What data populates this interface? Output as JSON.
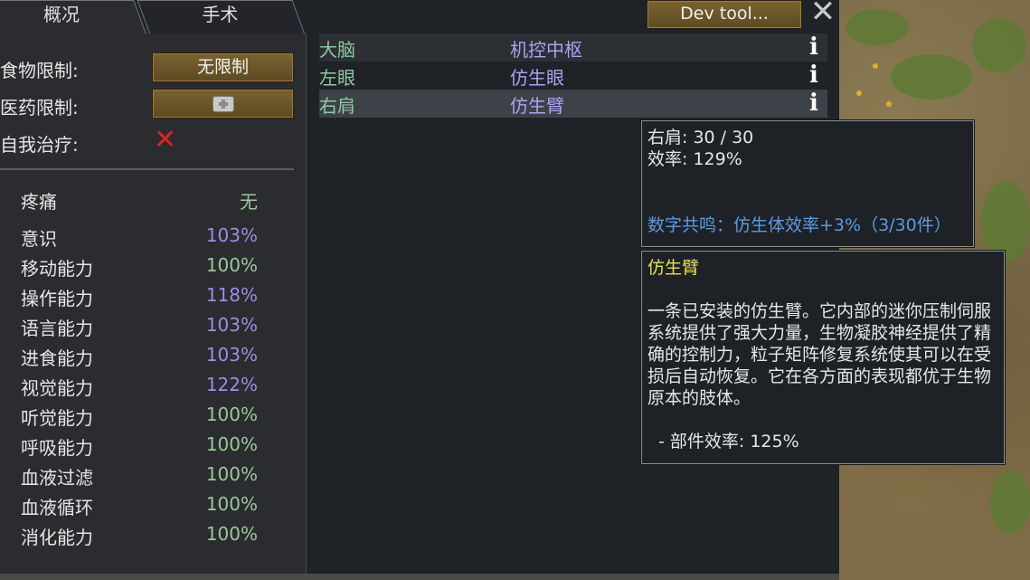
{
  "tabs": {
    "overview": "概况",
    "surgery": "手术"
  },
  "settings": {
    "food_label": "食物限制:",
    "food_value": "无限制",
    "medicine_label": "医药限制:",
    "medicine_icon": "medicine-icon",
    "self_tend_label": "自我治疗:",
    "self_tend_icon": "red-x-icon"
  },
  "pain": {
    "label": "疼痛",
    "value": "无"
  },
  "capacities": [
    {
      "name": "意识",
      "value": "103%",
      "color": "#9a8ee6"
    },
    {
      "name": "移动能力",
      "value": "100%",
      "color": "#9cc79a"
    },
    {
      "name": "操作能力",
      "value": "118%",
      "color": "#9a8ee6"
    },
    {
      "name": "语言能力",
      "value": "103%",
      "color": "#9a8ee6"
    },
    {
      "name": "进食能力",
      "value": "103%",
      "color": "#9a8ee6"
    },
    {
      "name": "视觉能力",
      "value": "122%",
      "color": "#9a8ee6"
    },
    {
      "name": "听觉能力",
      "value": "100%",
      "color": "#9cc79a"
    },
    {
      "name": "呼吸能力",
      "value": "100%",
      "color": "#9cc79a"
    },
    {
      "name": "血液过滤",
      "value": "100%",
      "color": "#9cc79a"
    },
    {
      "name": "血液循环",
      "value": "100%",
      "color": "#9cc79a"
    },
    {
      "name": "消化能力",
      "value": "100%",
      "color": "#9cc79a"
    }
  ],
  "parts": [
    {
      "part": "大脑",
      "hediff": "机控中枢"
    },
    {
      "part": "左眼",
      "hediff": "仿生眼"
    },
    {
      "part": "右肩",
      "hediff": "仿生臂"
    }
  ],
  "dev_tool": "Dev tool...",
  "tooltip_part": {
    "line1": "右肩:  30 / 30",
    "line2": "效率: 129%",
    "resonance": "数字共鸣：仿生体效率+3%（3/30件）"
  },
  "tooltip_hediff": {
    "title": "仿生臂",
    "description": "一条已安装的仿生臂。它内部的迷你压制伺服系统提供了强大力量，生物凝胶神经提供了精确的控制力，粒子矩阵修复系统使其可以在受损后自动恢复。它在各方面的表现都优于生物原本的肢体。",
    "stat": "- 部件效率: 125%"
  }
}
